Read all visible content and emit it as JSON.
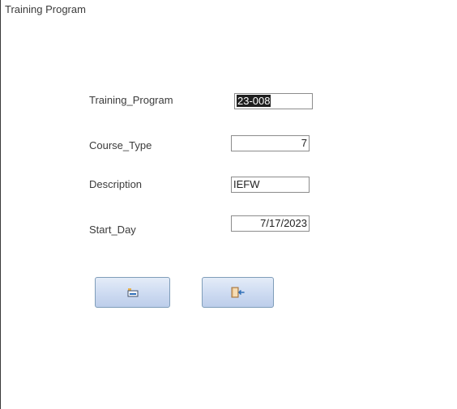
{
  "form": {
    "title": "Training Program"
  },
  "fields": {
    "training_program": {
      "label": "Training_Program",
      "value": "23-008"
    },
    "course_type": {
      "label": "Course_Type",
      "value": "7"
    },
    "description": {
      "label": "Description",
      "value": "IEFW"
    },
    "start_day": {
      "label": "Start_Day",
      "value": "7/17/2023"
    }
  },
  "buttons": {
    "first": {
      "icon": "save-record-icon"
    },
    "second": {
      "icon": "exit-door-icon"
    }
  },
  "colors": {
    "button_gradient_top": "#e4ecf8",
    "button_gradient_bottom": "#bccdea",
    "button_border": "#7f9db9",
    "selection": "#1f1f1f"
  }
}
